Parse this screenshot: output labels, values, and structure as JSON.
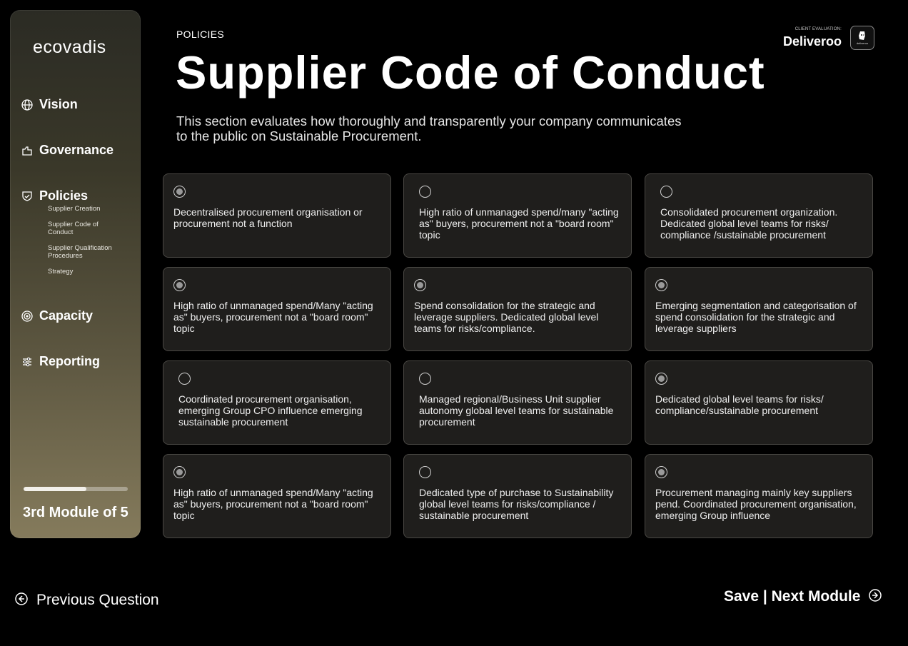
{
  "sidebar": {
    "logo": "ecovadis",
    "nav": [
      {
        "label": "Vision",
        "icon": "globe-icon"
      },
      {
        "label": "Governance",
        "icon": "handshake-icon"
      },
      {
        "label": "Policies",
        "icon": "shield-check-icon"
      },
      {
        "label": "Capacity",
        "icon": "target-icon"
      },
      {
        "label": "Reporting",
        "icon": "sliders-icon"
      }
    ],
    "policies_sub": [
      "Supplier Creation",
      "Supplier Code of Conduct",
      "Supplier Qualification Procedures",
      "Strategy"
    ],
    "progress_fraction": 0.6,
    "module_label": "3rd Module of 5"
  },
  "header": {
    "section": "POLICIES",
    "title": "Supplier Code of Conduct",
    "description": "This section evaluates how thoroughly and transparently your company communicates to the public on Sustainable Procurement.",
    "client_small": "CLIENT EVALUATION:",
    "client_name": "Deliveroo",
    "client_logo_text": "deliveroo"
  },
  "options": [
    {
      "text": "Decentralised procurement organisation or procurement not a function",
      "checked": true
    },
    {
      "text": "High ratio of unmanaged spend/many \"acting as\" buyers, procurement not a \"board room\" topic",
      "checked": false
    },
    {
      "text": "Consolidated procurement organization. Dedicated global level teams for risks/ compliance /sustainable procurement",
      "checked": false
    },
    {
      "text": "High ratio of unmanaged spend/Many \"acting as\" buyers, procurement not a \"board room\" topic",
      "checked": true
    },
    {
      "text": "Spend consolidation for the strategic and leverage suppliers. Dedicated global level teams for risks/compliance.",
      "checked": true
    },
    {
      "text": "Emerging segmentation and categorisation of spend consolidation for the strategic and leverage suppliers",
      "checked": true
    },
    {
      "text": "Coordinated procurement organisation, emerging Group CPO influence emerging sustainable procurement",
      "checked": false
    },
    {
      "text": "Managed regional/Business Unit supplier autonomy global level teams for sustainable procurement",
      "checked": false
    },
    {
      "text": "Dedicated global level teams for risks/ compliance/sustainable procurement",
      "checked": true
    },
    {
      "text": "High ratio of unmanaged spend/Many \"acting as\" buyers, procurement not a \"board room\" topic",
      "checked": true
    },
    {
      "text": "Dedicated type of purchase to Sustainability global level teams for risks/compliance / sustainable procurement",
      "checked": false
    },
    {
      "text": "Procurement managing mainly key suppliers pend. Coordinated procurement organisation, emerging Group influence",
      "checked": true
    }
  ],
  "footer": {
    "previous_label": "Previous Question",
    "next_label": "Save | Next Module"
  }
}
